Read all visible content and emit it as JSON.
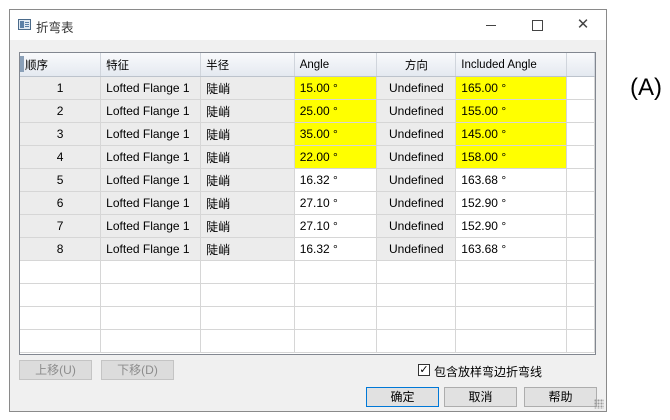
{
  "window": {
    "title": "折弯表"
  },
  "table": {
    "columns": [
      "顺序",
      "特征",
      "半径",
      "Angle",
      "方向",
      "Included Angle"
    ],
    "rows": [
      {
        "order": "1",
        "feature": "Lofted Flange 1",
        "radius": "陡峭",
        "angle": "15.00 °",
        "direction": "Undefined",
        "included": "165.00 °",
        "highlight": true
      },
      {
        "order": "2",
        "feature": "Lofted Flange 1",
        "radius": "陡峭",
        "angle": "25.00 °",
        "direction": "Undefined",
        "included": "155.00 °",
        "highlight": true
      },
      {
        "order": "3",
        "feature": "Lofted Flange 1",
        "radius": "陡峭",
        "angle": "35.00 °",
        "direction": "Undefined",
        "included": "145.00 °",
        "highlight": true
      },
      {
        "order": "4",
        "feature": "Lofted Flange 1",
        "radius": "陡峭",
        "angle": "22.00 °",
        "direction": "Undefined",
        "included": "158.00 °",
        "highlight": true
      },
      {
        "order": "5",
        "feature": "Lofted Flange 1",
        "radius": "陡峭",
        "angle": "16.32 °",
        "direction": "Undefined",
        "included": "163.68 °",
        "highlight": false
      },
      {
        "order": "6",
        "feature": "Lofted Flange 1",
        "radius": "陡峭",
        "angle": "27.10 °",
        "direction": "Undefined",
        "included": "152.90 °",
        "highlight": false
      },
      {
        "order": "7",
        "feature": "Lofted Flange 1",
        "radius": "陡峭",
        "angle": "27.10 °",
        "direction": "Undefined",
        "included": "152.90 °",
        "highlight": false
      },
      {
        "order": "8",
        "feature": "Lofted Flange 1",
        "radius": "陡峭",
        "angle": "16.32 °",
        "direction": "Undefined",
        "included": "163.68 °",
        "highlight": false
      }
    ],
    "empty_rows": 4
  },
  "buttons": {
    "move_up": "上移(U)",
    "move_down": "下移(D)",
    "ok": "确定",
    "cancel": "取消",
    "help": "帮助"
  },
  "checkbox": {
    "label": "包含放样弯边折弯线",
    "checked": true,
    "mark": "✓"
  },
  "annotation": "(A)",
  "colors": {
    "highlight": "#ffff00",
    "accent": "#0078d7"
  }
}
